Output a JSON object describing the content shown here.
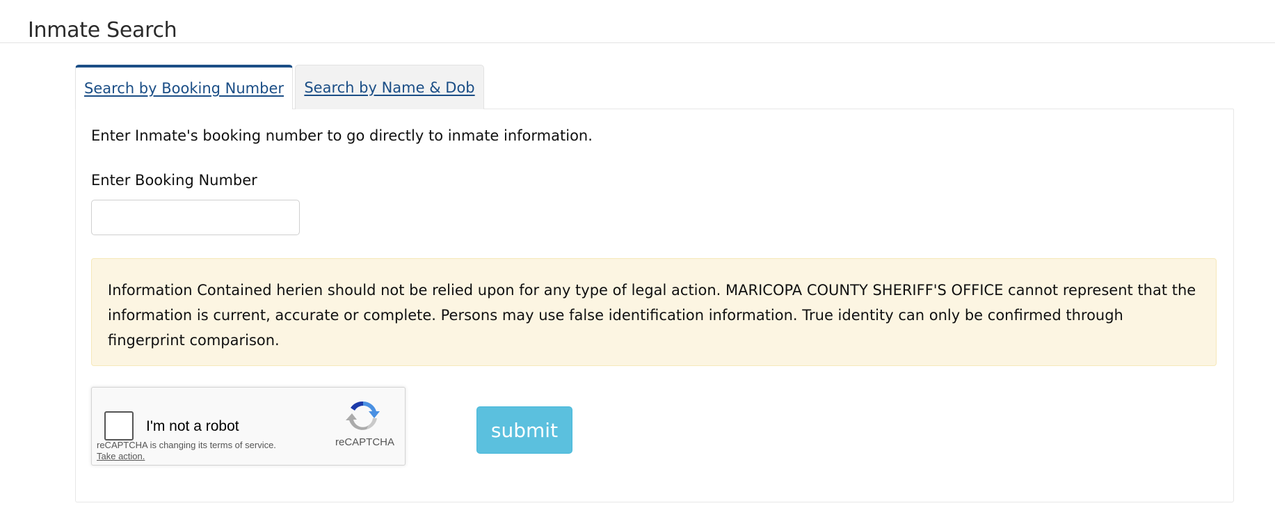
{
  "page": {
    "title": "Inmate Search"
  },
  "tabs": [
    {
      "label": "Search by Booking Number",
      "active": true
    },
    {
      "label": "Search by Name & Dob",
      "active": false
    }
  ],
  "booking_panel": {
    "intro": "Enter Inmate's booking number to go directly to inmate information.",
    "field_label": "Enter Booking Number",
    "input_value": "",
    "disclaimer": "Information Contained herien should not be relied upon for any type of legal action. MARICOPA COUNTY SHERIFF'S OFFICE cannot represent that the information is current, accurate or complete. Persons may use false identification information. True identity can only be confirmed through fingerprint comparison.",
    "submit_label": "submit"
  },
  "recaptcha": {
    "checkbox_label": "I'm not a robot",
    "brand": "reCAPTCHA",
    "terms_text": "reCAPTCHA is changing its terms of service.",
    "action_link": "Take action.",
    "icon": "recaptcha-logo-icon"
  },
  "colors": {
    "tab_accent": "#1b4e86",
    "disclaimer_bg": "#fcf5e2",
    "submit_bg": "#5bc0de"
  }
}
